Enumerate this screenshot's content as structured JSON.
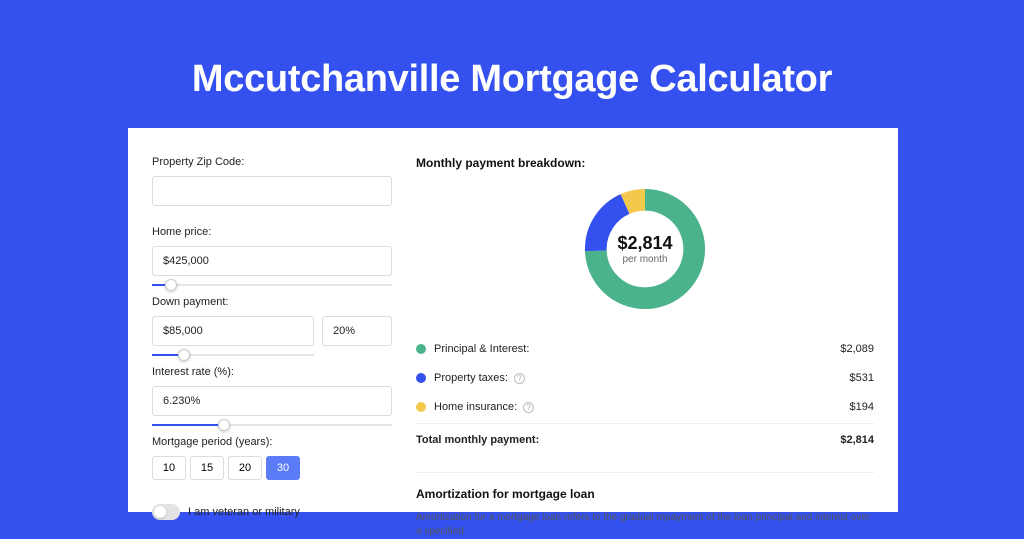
{
  "title": "Mccutchanville Mortgage Calculator",
  "left": {
    "zip_label": "Property Zip Code:",
    "zip_value": "",
    "price_label": "Home price:",
    "price_value": "$425,000",
    "price_slider_pct": 8,
    "down_label": "Down payment:",
    "down_value": "$85,000",
    "down_pct": "20%",
    "down_slider_pct": 20,
    "rate_label": "Interest rate (%):",
    "rate_value": "6.230%",
    "rate_slider_pct": 30,
    "period_label": "Mortgage period (years):",
    "periods": [
      "10",
      "15",
      "20",
      "30"
    ],
    "period_active": "30",
    "veteran_label": "I am veteran or military"
  },
  "breakdown": {
    "heading": "Monthly payment breakdown:",
    "total_value": "$2,814",
    "total_sub": "per month",
    "rows": [
      {
        "label": "Principal & Interest:",
        "amount": "$2,089",
        "color": "#4bb38c",
        "help": false
      },
      {
        "label": "Property taxes:",
        "amount": "$531",
        "color": "#3451f0",
        "help": true
      },
      {
        "label": "Home insurance:",
        "amount": "$194",
        "color": "#f2c94c",
        "help": true
      }
    ],
    "total_row": {
      "label": "Total monthly payment:",
      "amount": "$2,814"
    }
  },
  "amort": {
    "heading": "Amortization for mortgage loan",
    "body": "Amortization for a mortgage loan refers to the gradual repayment of the loan principal and interest over a specified"
  },
  "colors": {
    "green": "#4bb38c",
    "blue": "#3451f0",
    "yellow": "#f2c94c"
  },
  "chart_data": {
    "type": "pie",
    "title": "Monthly payment breakdown",
    "series": [
      {
        "name": "Principal & Interest",
        "value": 2089,
        "color": "#4bb38c"
      },
      {
        "name": "Property taxes",
        "value": 531,
        "color": "#3451f0"
      },
      {
        "name": "Home insurance",
        "value": 194,
        "color": "#f2c94c"
      }
    ],
    "total": 2814,
    "center_label": "$2,814 per month"
  }
}
